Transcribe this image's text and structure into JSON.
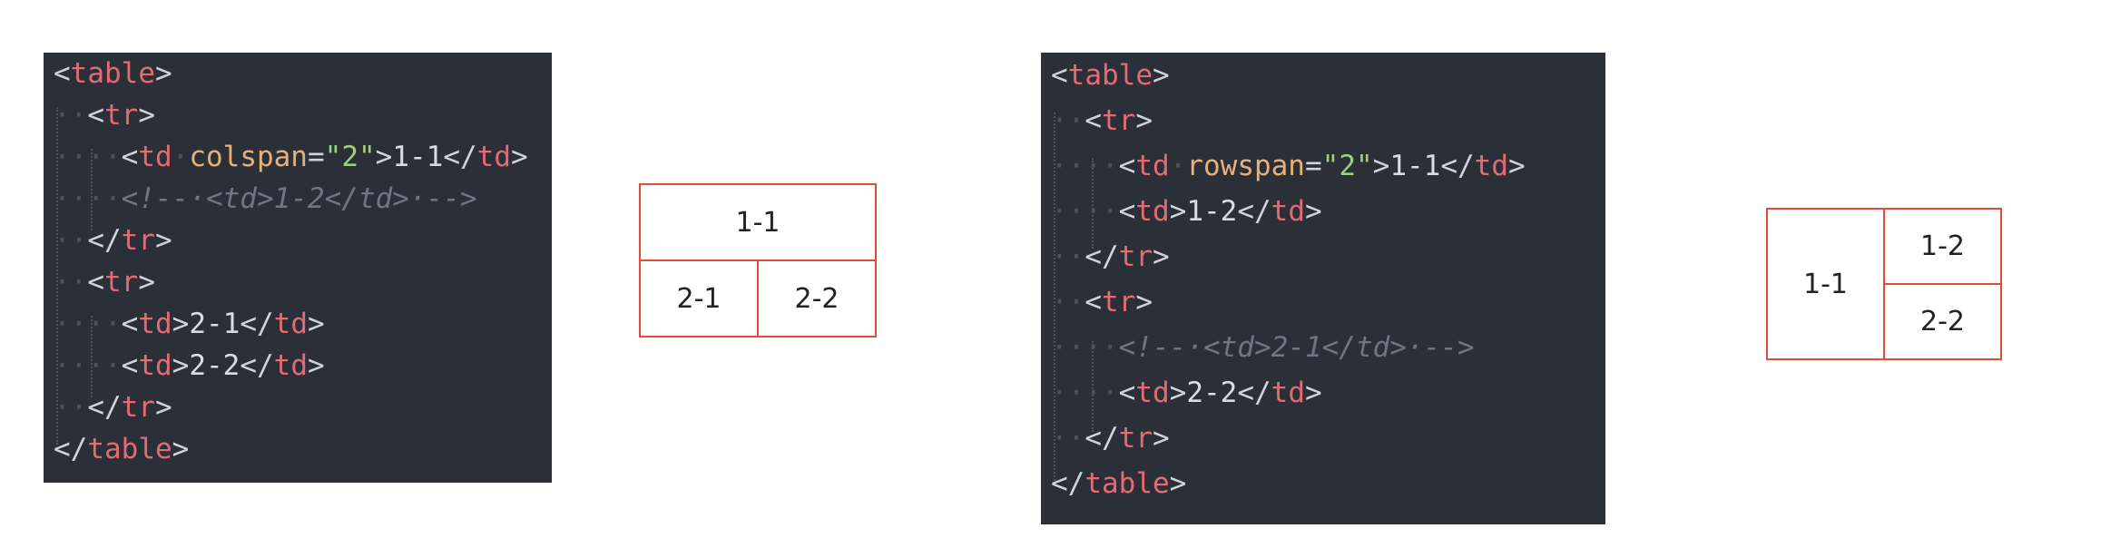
{
  "example_colspan": {
    "code": {
      "line1": {
        "open": "<",
        "tag": "table",
        "close": ">"
      },
      "line2": {
        "indent": "··",
        "open": "<",
        "tag": "tr",
        "close": ">"
      },
      "line3": {
        "indent": "····",
        "open": "<",
        "tag": "td",
        "sp": "·",
        "attr": "colspan",
        "eq": "=",
        "val": "\"2\"",
        "gt": ">",
        "text": "1-1",
        "close_open": "</",
        "close_tag": "td",
        "close_gt": ">"
      },
      "line4": {
        "indent": "····",
        "comment": "<!--·<td>1-2</td>·-->"
      },
      "line5": {
        "indent": "··",
        "open": "</",
        "tag": "tr",
        "close": ">"
      },
      "line6": {
        "indent": "··",
        "open": "<",
        "tag": "tr",
        "close": ">"
      },
      "line7": {
        "indent": "····",
        "open": "<",
        "tag": "td",
        "gt": ">",
        "text": "2-1",
        "close_open": "</",
        "close_tag": "td",
        "close_gt": ">"
      },
      "line8": {
        "indent": "····",
        "open": "<",
        "tag": "td",
        "gt": ">",
        "text": "2-2",
        "close_open": "</",
        "close_tag": "td",
        "close_gt": ">"
      },
      "line9": {
        "indent": "··",
        "open": "</",
        "tag": "tr",
        "close": ">"
      },
      "line10": {
        "open": "</",
        "tag": "table",
        "close": ">"
      }
    },
    "table": {
      "c11": "1-1",
      "c21": "2-1",
      "c22": "2-2"
    }
  },
  "example_rowspan": {
    "code": {
      "line1": {
        "open": "<",
        "tag": "table",
        "close": ">"
      },
      "line2": {
        "indent": "··",
        "open": "<",
        "tag": "tr",
        "close": ">"
      },
      "line3": {
        "indent": "····",
        "open": "<",
        "tag": "td",
        "sp": "·",
        "attr": "rowspan",
        "eq": "=",
        "val": "\"2\"",
        "gt": ">",
        "text": "1-1",
        "close_open": "</",
        "close_tag": "td",
        "close_gt": ">"
      },
      "line4": {
        "indent": "····",
        "open": "<",
        "tag": "td",
        "gt": ">",
        "text": "1-2",
        "close_open": "</",
        "close_tag": "td",
        "close_gt": ">"
      },
      "line5": {
        "indent": "··",
        "open": "</",
        "tag": "tr",
        "close": ">"
      },
      "line6": {
        "indent": "··",
        "open": "<",
        "tag": "tr",
        "close": ">"
      },
      "line7": {
        "indent": "····",
        "comment": "<!--·<td>2-1</td>·-->"
      },
      "line8": {
        "indent": "····",
        "open": "<",
        "tag": "td",
        "gt": ">",
        "text": "2-2",
        "close_open": "</",
        "close_tag": "td",
        "close_gt": ">"
      },
      "line9": {
        "indent": "··",
        "open": "</",
        "tag": "tr",
        "close": ">"
      },
      "line10": {
        "open": "</",
        "tag": "table",
        "close": ">"
      }
    },
    "table": {
      "c11": "1-1",
      "c12": "1-2",
      "c22": "2-2"
    }
  },
  "colors": {
    "editor_background": "#2b2f37",
    "tag": "#e36b74",
    "attribute": "#e6b07a",
    "string": "#9fcf7a",
    "comment": "#6e7583",
    "table_border": "#e34b36"
  }
}
